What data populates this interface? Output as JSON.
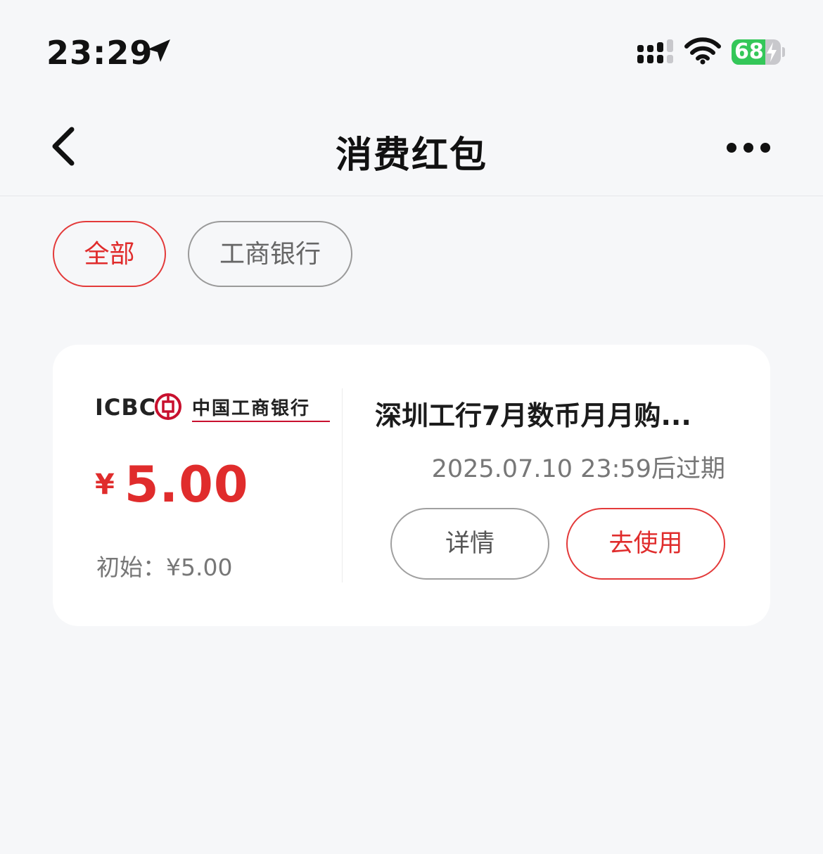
{
  "status_bar": {
    "time": "23:29",
    "battery_level": "68",
    "battery_fraction": 0.68,
    "battery_charging": true,
    "icons": [
      "location-arrow-icon",
      "cellular-signal-icon",
      "wifi-icon",
      "battery-icon",
      "charging-bolt-icon"
    ]
  },
  "nav": {
    "title": "消费红包",
    "back_icon": "chevron-left-icon",
    "more_icon": "more-dots-icon"
  },
  "filters": {
    "items": [
      {
        "label": "全部",
        "selected": true
      },
      {
        "label": "工商银行",
        "selected": false
      }
    ]
  },
  "voucher": {
    "bank": {
      "abbr": "ICBC",
      "name": "中国工商银行",
      "emblem_icon": "icbc-emblem-icon"
    },
    "currency_symbol": "¥",
    "amount": "5.00",
    "initial_label": "初始：",
    "initial_value": "¥5.00",
    "title": "深圳工行7月数币月月购...",
    "expiry": "2025.07.10 23:59后过期",
    "detail_label": "详情",
    "use_label": "去使用"
  },
  "colors": {
    "accent_red": "#e02c2c",
    "background": "#f6f7f9",
    "card": "#ffffff",
    "battery_green": "#34c759"
  }
}
